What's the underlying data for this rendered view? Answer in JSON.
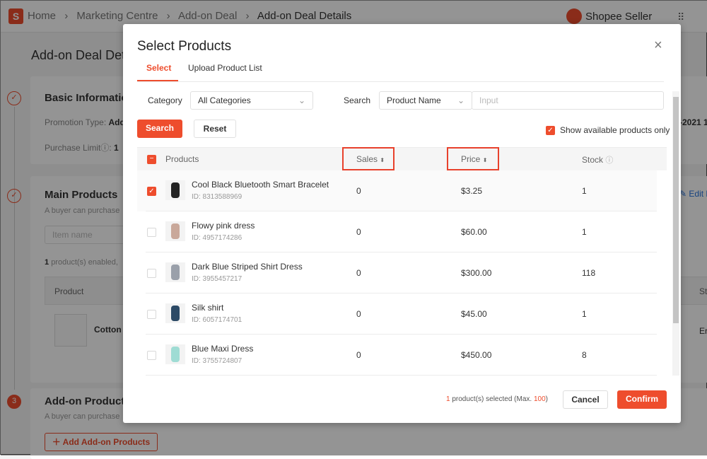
{
  "header": {
    "breadcrumb": [
      "Home",
      "Marketing Centre",
      "Add-on Deal",
      "Add-on Deal Details"
    ],
    "brand": "Shopee Seller"
  },
  "background": {
    "page_title": "Add-on Deal Det",
    "basic": {
      "title": "Basic Informatio",
      "promotion_label": "Promotion Type:",
      "promotion_value": "Add",
      "limit_label": "Purchase Limit",
      "limit_value": "1",
      "date_partial": "-2021 1"
    },
    "main": {
      "title": "Main Products",
      "desc": "A buyer can purchase",
      "search_placeholder": "Item name",
      "enabled_count": "1",
      "enabled_text": "product(s) enabled,",
      "col_product": "Product",
      "product_name": "Cotton s",
      "edit_label": "Edit M",
      "col_status": "St",
      "status_value": "Er"
    },
    "addon": {
      "step": "3",
      "title": "Add-on Products",
      "desc": "A buyer can purchase",
      "add_button": "Add Add-on Products"
    }
  },
  "modal": {
    "title": "Select Products",
    "tabs": [
      {
        "label": "Select",
        "active": true
      },
      {
        "label": "Upload Product List",
        "active": false
      }
    ],
    "filters": {
      "category_label": "Category",
      "category_value": "All Categories",
      "search_label": "Search",
      "search_type": "Product Name",
      "search_placeholder": "Input",
      "search_button": "Search",
      "reset_button": "Reset",
      "show_available_label": "Show available products only",
      "show_available_checked": true
    },
    "table": {
      "headers": {
        "products": "Products",
        "sales": "Sales",
        "price": "Price",
        "stock": "Stock"
      },
      "rows": [
        {
          "name": "Cool Black Bluetooth Smart Bracelet",
          "id": "ID: 8313588969",
          "sales": "0",
          "price": "$3.25",
          "stock": "1",
          "selected": true
        },
        {
          "name": "Flowy pink dress",
          "id": "ID: 4957174286",
          "sales": "0",
          "price": "$60.00",
          "stock": "1",
          "selected": false
        },
        {
          "name": "Dark Blue Striped Shirt Dress",
          "id": "ID: 3955457217",
          "sales": "0",
          "price": "$300.00",
          "stock": "118",
          "selected": false
        },
        {
          "name": "Silk shirt",
          "id": "ID: 6057174701",
          "sales": "0",
          "price": "$45.00",
          "stock": "1",
          "selected": false
        },
        {
          "name": "Blue Maxi Dress",
          "id": "ID: 3755724807",
          "sales": "0",
          "price": "$450.00",
          "stock": "8",
          "selected": false
        }
      ]
    },
    "footer": {
      "selected_count": "1",
      "selected_text": "product(s) selected (Max.",
      "max": "100",
      "close_paren": ")",
      "cancel": "Cancel",
      "confirm": "Confirm"
    }
  },
  "colors": {
    "accent": "#ee4d2d",
    "highlight": "#e8412c"
  }
}
